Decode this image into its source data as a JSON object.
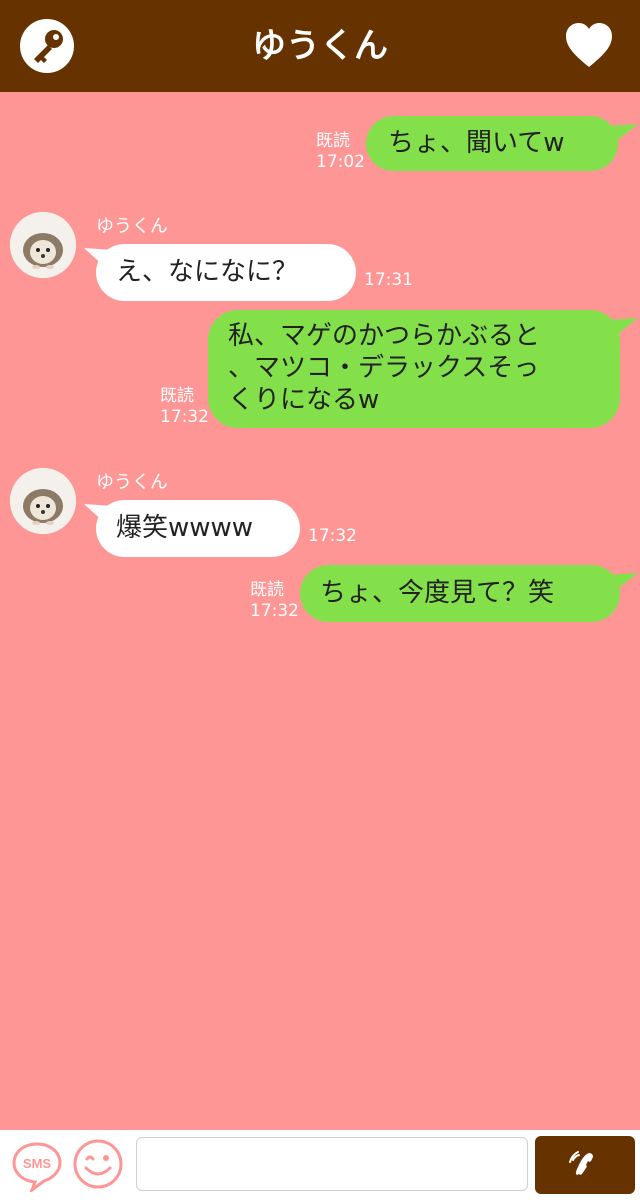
{
  "header": {
    "title": "ゆうくん",
    "left_icon": "key-icon",
    "right_icon": "heart-icon"
  },
  "colors": {
    "header_bg": "#663300",
    "chat_bg": "#ff9696",
    "outgoing_bubble": "#84e04a",
    "incoming_bubble": "#ffffff"
  },
  "messages": [
    {
      "direction": "out",
      "text": "ちょ、聞いてw",
      "read": "既読",
      "time": "17:02"
    },
    {
      "direction": "in",
      "sender": "ゆうくん",
      "avatar": "hedgehog-avatar",
      "text": "え、なになに？",
      "time": "17:31"
    },
    {
      "direction": "out",
      "text": "私、マゲのかつらかぶると\n、マツコ・デラックスそっ\nくりになるw",
      "read": "既読",
      "time": "17:32"
    },
    {
      "direction": "in",
      "sender": "ゆうくん",
      "avatar": "hedgehog-avatar",
      "text": "爆笑wwww",
      "time": "17:32"
    },
    {
      "direction": "out",
      "text": "ちょ、今度見て？笑",
      "read": "既読",
      "time": "17:32"
    }
  ],
  "bottom_bar": {
    "sms_label": "SMS",
    "emoji_icon": "smile-icon",
    "input_value": "",
    "input_placeholder": "",
    "call_icon": "phone-icon"
  }
}
